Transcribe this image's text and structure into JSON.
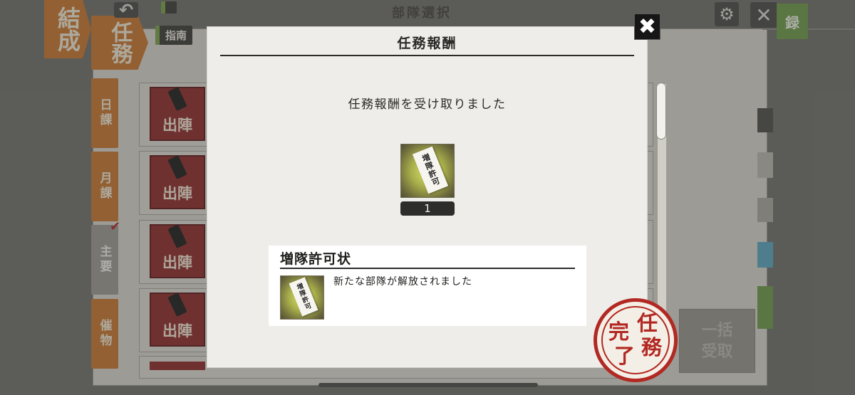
{
  "background": {
    "banner_formation": "結成",
    "banner_mission": "任務",
    "guide_button_label": "指南",
    "title_partial": "部隊選択",
    "side_tabs": [
      {
        "label": "日課"
      },
      {
        "label": "月課"
      },
      {
        "label": "主要"
      },
      {
        "label": "催物"
      }
    ],
    "sortie_label": "出陣",
    "collect_all_label": "一括受取",
    "green_tab_label": "録",
    "settings_icon": "gear-icon",
    "close_icon": "close-icon"
  },
  "modal": {
    "title": "任務報酬",
    "message": "任務報酬を受け取りました",
    "reward": {
      "icon": "reinforcement-permit-icon",
      "count": "1",
      "paper_text": "増隊許可"
    },
    "item_card": {
      "name": "増隊許可状",
      "description": "新たな部隊が解放されました",
      "paper_text": "増隊許可"
    },
    "close_icon": "close-icon"
  },
  "stamp": {
    "chars": [
      "任",
      "務",
      "完",
      "了"
    ],
    "text": "任務完了"
  },
  "colors": {
    "accent_orange": "#c8762f",
    "sortie_red": "#8e2a2a",
    "stamp_red": "#b22822",
    "modal_bg": "#efede9"
  }
}
